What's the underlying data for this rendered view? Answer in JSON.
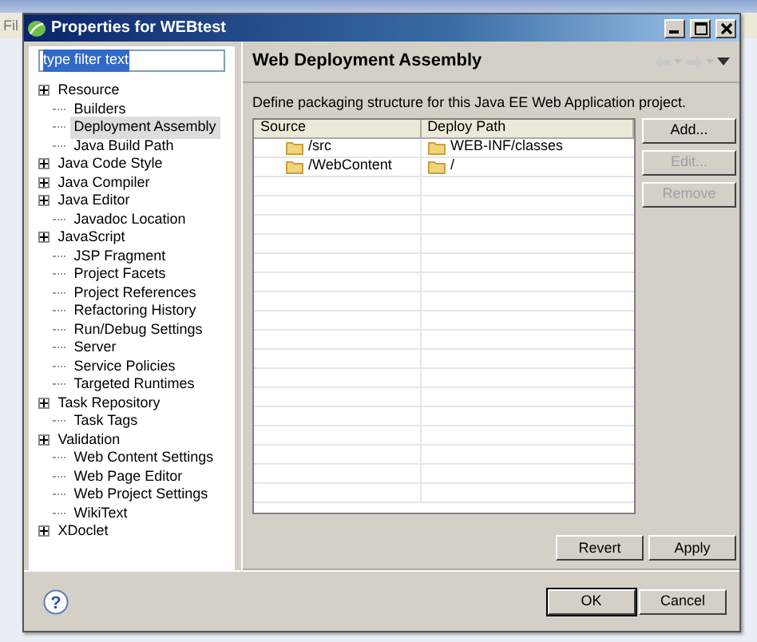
{
  "background": {
    "menu_label": "Fil"
  },
  "window": {
    "title": "Properties for WEBtest"
  },
  "filter": {
    "value": "type filter text"
  },
  "tree": [
    {
      "label": "Resource",
      "kind": "group",
      "selected": false
    },
    {
      "label": "Builders",
      "kind": "leaf",
      "selected": false
    },
    {
      "label": "Deployment Assembly",
      "kind": "leaf",
      "selected": true
    },
    {
      "label": "Java Build Path",
      "kind": "leaf",
      "selected": false
    },
    {
      "label": "Java Code Style",
      "kind": "group",
      "selected": false
    },
    {
      "label": "Java Compiler",
      "kind": "group",
      "selected": false
    },
    {
      "label": "Java Editor",
      "kind": "group",
      "selected": false
    },
    {
      "label": "Javadoc Location",
      "kind": "leaf",
      "selected": false
    },
    {
      "label": "JavaScript",
      "kind": "group",
      "selected": false
    },
    {
      "label": "JSP Fragment",
      "kind": "leaf",
      "selected": false
    },
    {
      "label": "Project Facets",
      "kind": "leaf",
      "selected": false
    },
    {
      "label": "Project References",
      "kind": "leaf",
      "selected": false
    },
    {
      "label": "Refactoring History",
      "kind": "leaf",
      "selected": false
    },
    {
      "label": "Run/Debug Settings",
      "kind": "leaf",
      "selected": false
    },
    {
      "label": "Server",
      "kind": "leaf",
      "selected": false
    },
    {
      "label": "Service Policies",
      "kind": "leaf",
      "selected": false
    },
    {
      "label": "Targeted Runtimes",
      "kind": "leaf",
      "selected": false
    },
    {
      "label": "Task Repository",
      "kind": "group",
      "selected": false
    },
    {
      "label": "Task Tags",
      "kind": "leaf",
      "selected": false
    },
    {
      "label": "Validation",
      "kind": "group",
      "selected": false
    },
    {
      "label": "Web Content Settings",
      "kind": "leaf",
      "selected": false
    },
    {
      "label": "Web Page Editor",
      "kind": "leaf",
      "selected": false
    },
    {
      "label": "Web Project Settings",
      "kind": "leaf",
      "selected": false
    },
    {
      "label": "WikiText",
      "kind": "leaf",
      "selected": false
    },
    {
      "label": "XDoclet",
      "kind": "group",
      "selected": false
    }
  ],
  "page": {
    "title": "Web Deployment Assembly",
    "description": "Define packaging structure for this Java EE Web Application project."
  },
  "table": {
    "columns": [
      "Source",
      "Deploy Path"
    ],
    "rows": [
      {
        "source": "/src",
        "deploy_path": "WEB-INF/classes"
      },
      {
        "source": "/WebContent",
        "deploy_path": "/"
      }
    ]
  },
  "side_buttons": [
    {
      "label": "Add...",
      "disabled": false
    },
    {
      "label": "Edit...",
      "disabled": true
    },
    {
      "label": "Remove",
      "disabled": true
    }
  ],
  "page_buttons": [
    {
      "label": "Revert",
      "disabled": false
    },
    {
      "label": "Apply",
      "disabled": false
    }
  ],
  "help": {
    "glyph": "?"
  },
  "dialog_buttons": [
    {
      "label": "OK",
      "default": true
    },
    {
      "label": "Cancel",
      "default": false
    }
  ]
}
